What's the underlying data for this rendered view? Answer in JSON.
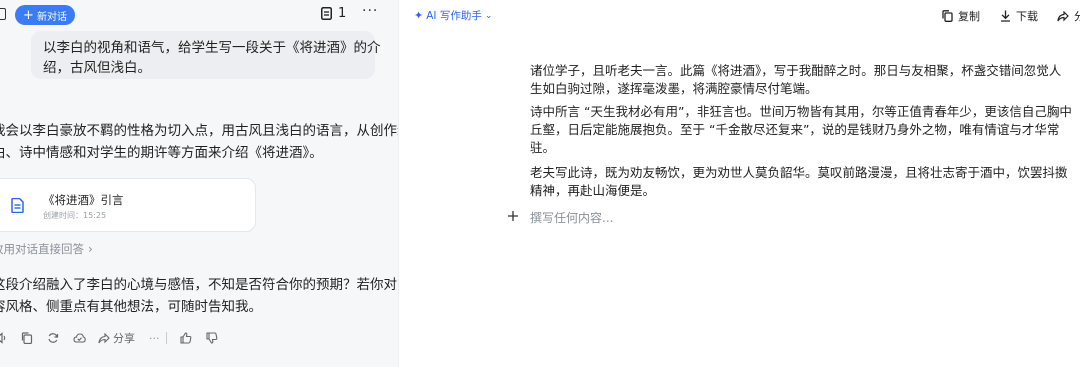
{
  "chat": {
    "new_chat_label": "新对话",
    "doc_count": "1",
    "more_label": "···",
    "user_message": [
      "以李白的视角和语气，给学生写一段关于《将进酒》的介",
      "绍，古风但浅白。"
    ],
    "ai_intro": [
      "我会以李白豪放不羁的性格为切入点，用古风且浅白的语言，从创作缘",
      "由、诗中情感和对学生的期许等方面来介绍《将进酒》。"
    ],
    "doc_card": {
      "title": "《将进酒》引言",
      "created": "创建时间：15:25"
    },
    "direct_answer_label": "改用对话直接回答",
    "ai_followup": [
      "这段介绍融入了李白的心境与感悟，不知是否符合你的预期？若你对内",
      "容风格、侧重点有其他想法，可随时告知我。"
    ],
    "actions": {
      "share_label": "分享",
      "more_label": "···"
    }
  },
  "editor": {
    "assistant_label": "AI 写作助手",
    "copy_label": "复制",
    "download_label": "下载",
    "share_label": "分",
    "paragraphs": [
      [
        "诸位学子，且听老夫一言。此篇《将进酒》，写于我酣醉之时。那日与友相聚，杯盏交错间忽觉人",
        "生如白驹过隙，遂挥毫泼墨，将满腔豪情尽付笔端。"
      ],
      [
        "诗中所言 “天生我材必有用”，非狂言也。世间万物皆有其用，尔等正值青春年少，更该信自己胸中",
        "丘壑，日后定能施展抱负。至于 “千金散尽还复来”，说的是钱财乃身外之物，唯有情谊与才华常",
        "驻。"
      ],
      [
        "老夫写此诗，既为劝友畅饮，更为劝世人莫负韶华。莫叹前路漫漫，且将壮志寄于酒中，饮罢抖擞",
        "精神，再赴山海便是。"
      ]
    ],
    "placeholder": "撰写任何内容..."
  },
  "colors": {
    "accent": "#3b7cf6",
    "panel_bg": "#f6f7f9",
    "bubble_bg": "#eceef2"
  }
}
